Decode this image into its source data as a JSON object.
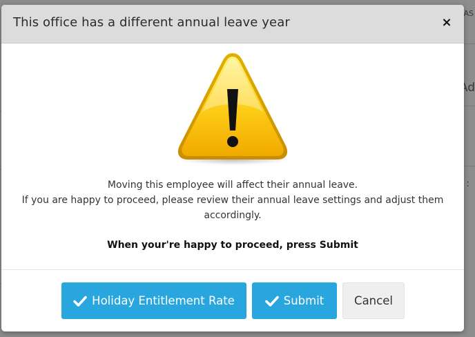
{
  "modal": {
    "title": "This office has a different annual leave year",
    "close_label": "×",
    "message_lines": [
      "Moving this employee will affect their annual leave.",
      "If you are happy to proceed, please review their annual leave settings and adjust them",
      "accordingly."
    ],
    "instruction": "When your're happy to proceed, press Submit",
    "buttons": {
      "holiday_label": "Holiday Entitlement Rate",
      "submit_label": "Submit",
      "cancel_label": "Cancel"
    }
  },
  "background": {
    "fragment_top": "AS",
    "fragment_mid": "Ad",
    "fragment_colon": ":"
  },
  "icons": {
    "warning": "warning-triangle-icon",
    "check": "check-icon",
    "close": "close-icon"
  },
  "colors": {
    "primary": "#2aa6df",
    "header_bg": "#dcdcdc",
    "warning_yellow": "#f5c400"
  }
}
